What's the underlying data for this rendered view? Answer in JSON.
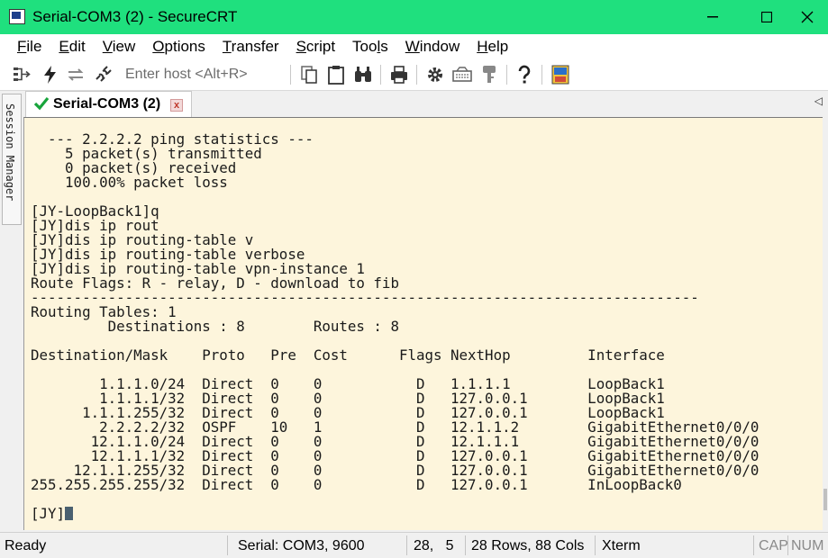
{
  "window": {
    "title": "Serial-COM3 (2) - SecureCRT",
    "minimize": "—",
    "maximize": "☐",
    "close": "✕"
  },
  "menu": [
    {
      "pre": "",
      "key": "F",
      "post": "ile"
    },
    {
      "pre": "",
      "key": "E",
      "post": "dit"
    },
    {
      "pre": "",
      "key": "V",
      "post": "iew"
    },
    {
      "pre": "",
      "key": "O",
      "post": "ptions"
    },
    {
      "pre": "",
      "key": "T",
      "post": "ransfer"
    },
    {
      "pre": "",
      "key": "S",
      "post": "cript"
    },
    {
      "pre": "Too",
      "key": "l",
      "post": "s"
    },
    {
      "pre": "",
      "key": "W",
      "post": "indow"
    },
    {
      "pre": "",
      "key": "H",
      "post": "elp"
    }
  ],
  "toolbar": {
    "host_placeholder": "Enter host <Alt+R>",
    "icons": [
      "connect-icon",
      "lightning-icon",
      "reconnect-icon",
      "disconnect-icon",
      "copy-icon",
      "paste-icon",
      "find-icon",
      "print-icon",
      "settings-icon",
      "keymap-icon",
      "key-icon",
      "help-icon",
      "sftp-icon"
    ]
  },
  "session_manager": {
    "label": "Session Manager"
  },
  "tab": {
    "label": "Serial-COM3 (2)",
    "close": "x",
    "arrow": "◁"
  },
  "terminal": {
    "lines": [
      "  --- 2.2.2.2 ping statistics ---",
      "    5 packet(s) transmitted",
      "    0 packet(s) received",
      "    100.00% packet loss",
      "",
      "[JY-LoopBack1]q",
      "[JY]dis ip rout",
      "[JY]dis ip routing-table v",
      "[JY]dis ip routing-table verbose",
      "[JY]dis ip routing-table vpn-instance 1",
      "Route Flags: R - relay, D - download to fib",
      "------------------------------------------------------------------------------",
      "Routing Tables: 1",
      "         Destinations : 8        Routes : 8",
      "",
      "Destination/Mask    Proto   Pre  Cost      Flags NextHop         Interface",
      "",
      "        1.1.1.0/24  Direct  0    0           D   1.1.1.1         LoopBack1",
      "        1.1.1.1/32  Direct  0    0           D   127.0.0.1       LoopBack1",
      "      1.1.1.255/32  Direct  0    0           D   127.0.0.1       LoopBack1",
      "        2.2.2.2/32  OSPF    10   1           D   12.1.1.2        GigabitEthernet0/0/0",
      "       12.1.1.0/24  Direct  0    0           D   12.1.1.1        GigabitEthernet0/0/0",
      "       12.1.1.1/32  Direct  0    0           D   127.0.0.1       GigabitEthernet0/0/0",
      "     12.1.1.255/32  Direct  0    0           D   127.0.0.1       GigabitEthernet0/0/0",
      "255.255.255.255/32  Direct  0    0           D   127.0.0.1       InLoopBack0",
      "",
      "[JY]"
    ]
  },
  "status": {
    "ready": "Ready",
    "connection": "Serial: COM3, 9600",
    "cursor_pos": "28,   5",
    "size": "28 Rows, 88 Cols",
    "emulation": "Xterm",
    "cap": "CAP",
    "num": "NUM"
  },
  "colors": {
    "titlebar": "#1fe07e",
    "terminal_bg": "#fdf5dc",
    "terminal_fg": "#1a1a1a"
  }
}
